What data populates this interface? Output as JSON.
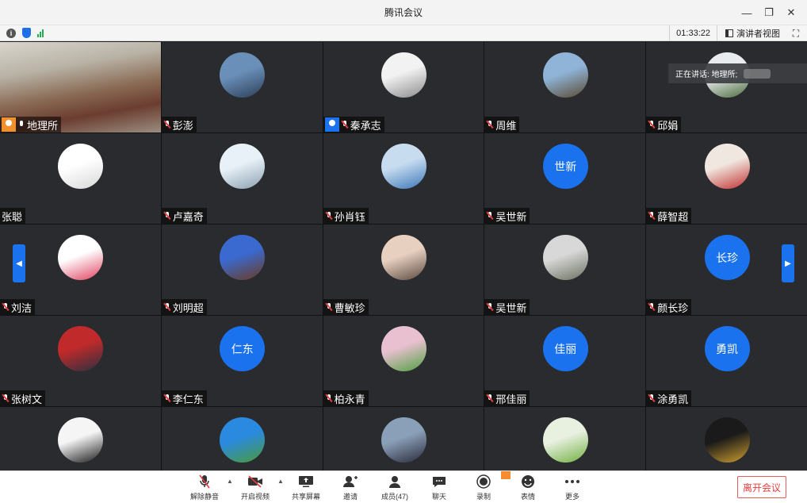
{
  "window": {
    "title": "腾讯会议"
  },
  "status": {
    "timer": "01:33:22",
    "speaker_view": "演讲者视图"
  },
  "speaking": {
    "label": "正在讲话: 地理所;"
  },
  "colors": {
    "accent": "#1a72ef",
    "leave": "#e23d3d",
    "host_orange": "#f0902e"
  },
  "participants": [
    {
      "name": "地理所",
      "avatar": "video",
      "badge": "orange",
      "mic": "on"
    },
    {
      "name": "彭澎",
      "avatar": "photo",
      "mic": "off",
      "c1": "#6a8fb8",
      "c2": "#2c3e58"
    },
    {
      "name": "秦承志",
      "avatar": "photo",
      "badge": "blue",
      "mic": "off",
      "c1": "#f2f2f2",
      "c2": "#8a8a8a"
    },
    {
      "name": "周维",
      "avatar": "photo",
      "mic": "off",
      "c1": "#8fb4d8",
      "c2": "#5a4a30"
    },
    {
      "name": "邱娟",
      "avatar": "photo",
      "mic": "off",
      "c1": "#e8ecee",
      "c2": "#4a6a3a"
    },
    {
      "name": "张聪",
      "avatar": "photo",
      "mic": "none",
      "c1": "#ffffff",
      "c2": "#d8d8d8"
    },
    {
      "name": "卢嘉奇",
      "avatar": "photo",
      "mic": "off",
      "c1": "#e9f1f8",
      "c2": "#8aa0b0"
    },
    {
      "name": "孙肖钰",
      "avatar": "photo",
      "mic": "off",
      "c1": "#c8dcf0",
      "c2": "#3c78b8"
    },
    {
      "name": "吴世新",
      "avatar": "text",
      "text": "世新",
      "mic": "off"
    },
    {
      "name": "薛智超",
      "avatar": "photo",
      "mic": "off",
      "c1": "#f0e8e0",
      "c2": "#c23030"
    },
    {
      "name": "刘洁",
      "avatar": "photo",
      "mic": "off",
      "c1": "#ffffff",
      "c2": "#e04060"
    },
    {
      "name": "刘明超",
      "avatar": "photo",
      "mic": "off",
      "c1": "#3a6ad0",
      "c2": "#6a3a20"
    },
    {
      "name": "曹敏珍",
      "avatar": "photo",
      "mic": "off",
      "c1": "#e8d0c0",
      "c2": "#5a4a40"
    },
    {
      "name": "吴世新",
      "avatar": "photo",
      "mic": "off",
      "c1": "#d8d8d8",
      "c2": "#6a7060"
    },
    {
      "name": "颜长珍",
      "avatar": "text",
      "text": "长珍",
      "mic": "off"
    },
    {
      "name": "张树文",
      "avatar": "photo",
      "mic": "off",
      "c1": "#c02a2a",
      "c2": "#2a3040"
    },
    {
      "name": "李仁东",
      "avatar": "text",
      "text": "仁东",
      "mic": "off"
    },
    {
      "name": "柏永青",
      "avatar": "photo",
      "mic": "off",
      "c1": "#e8c0d0",
      "c2": "#50a040"
    },
    {
      "name": "邢佳丽",
      "avatar": "text",
      "text": "佳丽",
      "mic": "off"
    },
    {
      "name": "涂勇凯",
      "avatar": "text",
      "text": "勇凯",
      "mic": "off"
    },
    {
      "name": "",
      "avatar": "photo",
      "mic": "none",
      "c1": "#f5f5f5",
      "c2": "#1a1a1a"
    },
    {
      "name": "",
      "avatar": "photo",
      "mic": "none",
      "c1": "#2a8ae0",
      "c2": "#4a9a3a"
    },
    {
      "name": "",
      "avatar": "photo",
      "mic": "none",
      "c1": "#8aa0b8",
      "c2": "#2a2a3a"
    },
    {
      "name": "",
      "avatar": "photo",
      "mic": "none",
      "c1": "#e8f0e0",
      "c2": "#70b040"
    },
    {
      "name": "",
      "avatar": "photo",
      "mic": "none",
      "c1": "#1a1a1a",
      "c2": "#d0a030"
    }
  ],
  "toolbar": {
    "unmute": "解除静音",
    "video": "开启视频",
    "share": "共享屏幕",
    "invite": "邀请",
    "members": "成员(47)",
    "chat": "聊天",
    "record": "录制",
    "emoji": "表情",
    "more": "更多",
    "leave": "离开会议"
  }
}
